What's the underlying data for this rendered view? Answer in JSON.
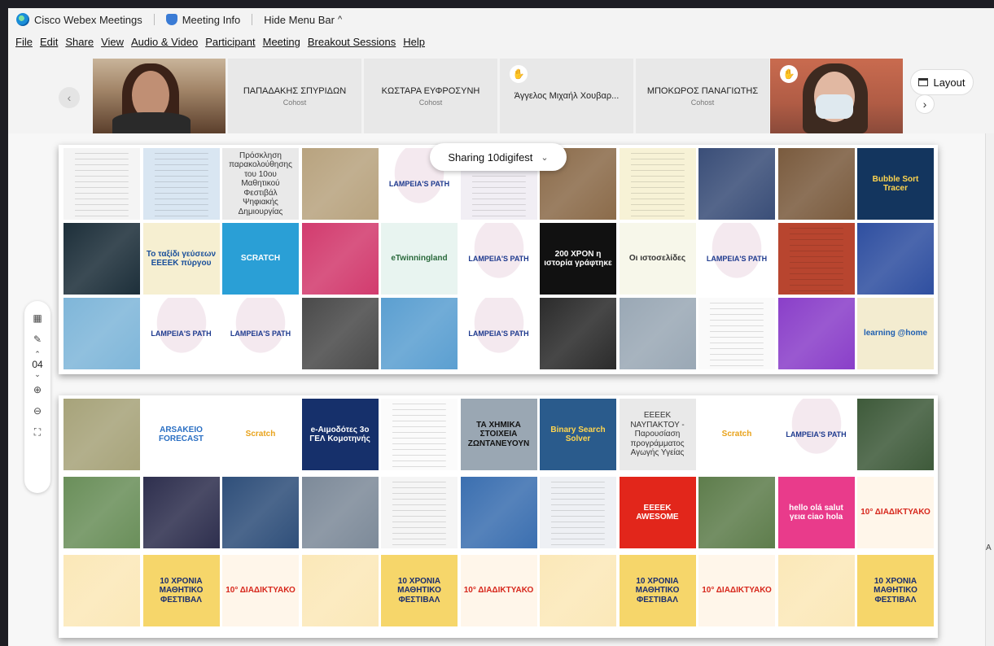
{
  "titlebar": {
    "app_name": "Cisco Webex Meetings",
    "meeting_info": "Meeting Info",
    "hide_menu": "Hide Menu Bar",
    "hide_menu_chevron": "^"
  },
  "menu": [
    "File",
    "Edit",
    "Share",
    "View",
    "Audio & Video",
    "Participant",
    "Meeting",
    "Breakout Sessions",
    "Help"
  ],
  "participants": [
    {
      "name": "",
      "role": "",
      "kind": "video"
    },
    {
      "name": "ΠΑΠΑΔΑΚΗΣ ΣΠΥΡΙΔΩΝ",
      "role": "Cohost",
      "kind": "name"
    },
    {
      "name": "ΚΩΣΤΑΡΑ ΕΥΦΡΟΣΥΝΗ",
      "role": "Cohost",
      "kind": "name"
    },
    {
      "name": "Άγγελος Μιχαήλ Χουβαρ...",
      "role": "",
      "kind": "name",
      "hand": true
    },
    {
      "name": "ΜΠΟΚΩΡΟΣ ΠΑΝΑΓΙΩΤΗΣ",
      "role": "Cohost",
      "kind": "name"
    },
    {
      "name": "",
      "role": "",
      "kind": "video",
      "hand": true
    }
  ],
  "layout_button": "Layout",
  "sharing": {
    "label": "Sharing 10digifest"
  },
  "tools": {
    "page": "04"
  },
  "board1": {
    "rows": [
      [
        {
          "type": "doc",
          "color": "#f4f4f4"
        },
        {
          "type": "doc",
          "color": "#d9e6f2"
        },
        {
          "type": "text",
          "text": "Πρόσκληση παρακολούθησης του 10ου Μαθητικού Φεστιβάλ Ψηφιακής Δημιουργίας"
        },
        {
          "type": "photo",
          "color": "#b8a37f"
        },
        {
          "type": "tree",
          "text": "LAMPEIA'S PATH"
        },
        {
          "type": "doc",
          "color": "#f1eef4"
        },
        {
          "type": "photo",
          "color": "#8b6b4a"
        },
        {
          "type": "doc",
          "color": "#f7f2d6"
        },
        {
          "type": "photo",
          "color": "#3a4e78"
        },
        {
          "type": "photo",
          "color": "#7a5b3e"
        },
        {
          "type": "text",
          "text": "Bubble Sort Tracer",
          "color": "#13355e",
          "fg": "#ffd54f"
        }
      ],
      [
        {
          "type": "photo",
          "color": "#1d2f3a"
        },
        {
          "type": "text",
          "text": "Το ταξίδι γεύσεων ΕΕΕΕΚ πύργου",
          "color": "#f6efd1",
          "fg": "#1a4f9a"
        },
        {
          "type": "text",
          "text": "SCRATCH",
          "color": "#2a9fd6",
          "fg": "#ffffff"
        },
        {
          "type": "photo",
          "color": "#d23b6e"
        },
        {
          "type": "text",
          "text": "eTwinningland",
          "color": "#e8f4f0",
          "fg": "#2b6a3d"
        },
        {
          "type": "tree",
          "text": "LAMPEIA'S PATH"
        },
        {
          "type": "text",
          "text": "200 ΧΡΟΝ η ιστορία γράφτηκε",
          "color": "#111111",
          "fg": "#ffffff"
        },
        {
          "type": "text",
          "text": "Οι ιστοσελίδες",
          "color": "#f7f7ea",
          "fg": "#333333"
        },
        {
          "type": "tree",
          "text": "LAMPEIA'S PATH"
        },
        {
          "type": "doc",
          "color": "#b8452f"
        },
        {
          "type": "photo",
          "color": "#2f4fa0"
        }
      ],
      [
        {
          "type": "photo",
          "color": "#7fb6d9"
        },
        {
          "type": "tree",
          "text": "LAMPEIA'S PATH"
        },
        {
          "type": "tree",
          "text": "LAMPEIA'S PATH"
        },
        {
          "type": "photo",
          "color": "#4a4a4a"
        },
        {
          "type": "photo",
          "color": "#5b9fd1"
        },
        {
          "type": "tree",
          "text": "LAMPEIA'S PATH"
        },
        {
          "type": "photo",
          "color": "#2b2b2b"
        },
        {
          "type": "photo",
          "color": "#9aa8b5"
        },
        {
          "type": "doc",
          "color": "#fafafa"
        },
        {
          "type": "photo",
          "color": "#8a3fc9"
        },
        {
          "type": "text",
          "text": "learning @home",
          "color": "#f3ecd0",
          "fg": "#1f5fb0"
        }
      ]
    ]
  },
  "board2": {
    "rows": [
      [
        {
          "type": "photo",
          "color": "#a7a37a"
        },
        {
          "type": "text",
          "text": "ARSAKEIO FORECAST",
          "color": "#ffffff",
          "fg": "#2a6fc3"
        },
        {
          "type": "text",
          "text": "Scratch",
          "color": "#ffffff",
          "fg": "#e8a21a"
        },
        {
          "type": "text",
          "text": "e-Αιμοδότες 3ο ΓΕΛ Κομοτηνής",
          "color": "#16306b",
          "fg": "#ffffff"
        },
        {
          "type": "doc",
          "color": "#fbfbfb"
        },
        {
          "type": "text",
          "text": "ΤΑ ΧΗΜΙΚΑ ΣΤΟΙΧΕΙΑ ΖΩΝΤΑΝΕΥΟΥΝ",
          "color": "#9aa7b3",
          "fg": "#111111"
        },
        {
          "type": "text",
          "text": "Binary Search Solver",
          "color": "#2a5b8c",
          "fg": "#ffd54f"
        },
        {
          "type": "text",
          "text": "ΕΕΕΕΚ ΝΑΥΠΑΚΤΟΥ - Παρουσίαση προγράμματος Αγωγής Υγείας"
        },
        {
          "type": "text",
          "text": "Scratch",
          "color": "#ffffff",
          "fg": "#e8a21a"
        },
        {
          "type": "tree",
          "text": "LAMPEIA'S PATH"
        },
        {
          "type": "photo",
          "color": "#3e5a3a"
        }
      ],
      [
        {
          "type": "photo",
          "color": "#6a8f5a"
        },
        {
          "type": "photo",
          "color": "#2e2f4e"
        },
        {
          "type": "photo",
          "color": "#2f4f7a"
        },
        {
          "type": "photo",
          "color": "#7d8a99"
        },
        {
          "type": "doc",
          "color": "#f5f5f5"
        },
        {
          "type": "photo",
          "color": "#3b6fb0"
        },
        {
          "type": "doc",
          "color": "#eef0f4"
        },
        {
          "type": "text",
          "text": "ΕΕΕΕΚ AWESOME",
          "color": "#e2261b",
          "fg": "#ffffff"
        },
        {
          "type": "photo",
          "color": "#5e7d4c"
        },
        {
          "type": "text",
          "text": "hello olá salut γεια ciao hola",
          "color": "#e93b8b",
          "fg": "#ffffff"
        },
        {
          "type": "text",
          "text": "10° ΔΙΑΔΙΚΤΥΑΚΟ",
          "color": "#fff6ea",
          "fg": "#d7271c"
        }
      ],
      [
        {
          "type": "photo",
          "color": "#fbe8b8"
        },
        {
          "type": "text",
          "text": "10 ΧΡΟΝΙΑ ΜΑΘΗΤΙΚΟ ΦΕΣΤΙΒΑΛ",
          "color": "#f6d66a",
          "fg": "#1b2e6e"
        },
        {
          "type": "text",
          "text": "10° ΔΙΑΔΙΚΤΥΑΚΟ",
          "color": "#fff6ea",
          "fg": "#d7271c"
        },
        {
          "type": "photo",
          "color": "#fbe8b8"
        },
        {
          "type": "text",
          "text": "10 ΧΡΟΝΙΑ ΜΑΘΗΤΙΚΟ ΦΕΣΤΙΒΑΛ",
          "color": "#f6d66a",
          "fg": "#1b2e6e"
        },
        {
          "type": "text",
          "text": "10° ΔΙΑΔΙΚΤΥΑΚΟ",
          "color": "#fff6ea",
          "fg": "#d7271c"
        },
        {
          "type": "photo",
          "color": "#fbe8b8"
        },
        {
          "type": "text",
          "text": "10 ΧΡΟΝΙΑ ΜΑΘΗΤΙΚΟ ΦΕΣΤΙΒΑΛ",
          "color": "#f6d66a",
          "fg": "#1b2e6e"
        },
        {
          "type": "text",
          "text": "10° ΔΙΑΔΙΚΤΥΑΚΟ",
          "color": "#fff6ea",
          "fg": "#d7271c"
        },
        {
          "type": "photo",
          "color": "#fbe8b8"
        },
        {
          "type": "text",
          "text": "10 ΧΡΟΝΙΑ ΜΑΘΗΤΙΚΟ ΦΕΣΤΙΒΑΛ",
          "color": "#f6d66a",
          "fg": "#1b2e6e"
        }
      ]
    ]
  },
  "right_edge_text": "A"
}
